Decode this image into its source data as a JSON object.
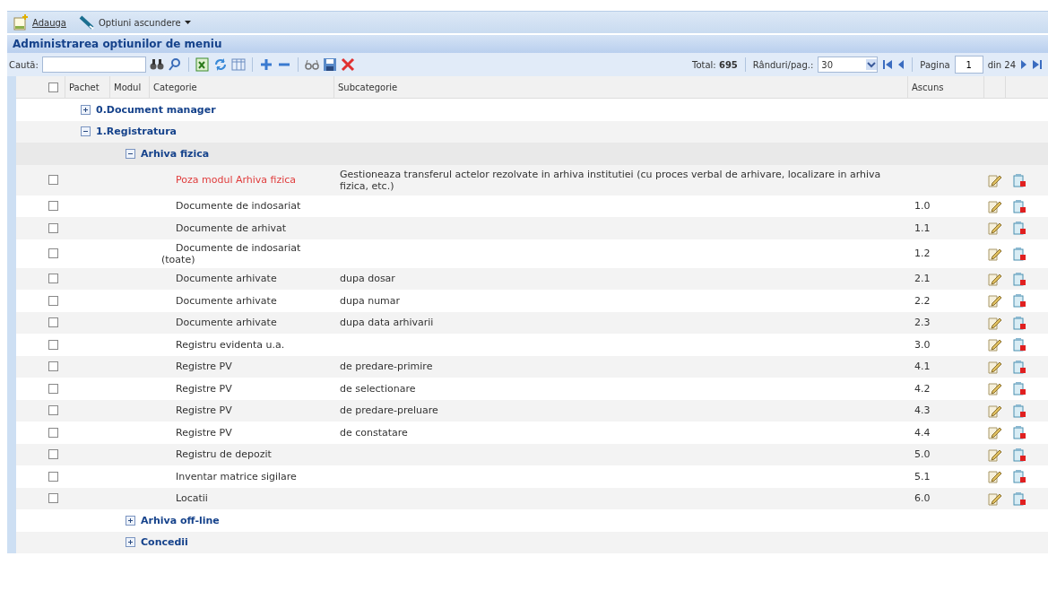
{
  "toolbar": {
    "buttons": [
      {
        "kind": "add",
        "label": "Adauga"
      },
      {
        "kind": "hide",
        "label": "Optiuni ascundere",
        "dropdown": true
      }
    ]
  },
  "panel_title": "Administrarea optiunilor de meniu",
  "search": {
    "label": "Cautã:"
  },
  "pager": {
    "total_label": "Total:",
    "total": "695",
    "rows_label": "Rânduri/pag.:",
    "rows_per_page": "30",
    "page_label": "Pagina",
    "page": "1",
    "of_label": "din 24"
  },
  "table": {
    "columns": [
      {
        "kind": "check",
        "checked": false
      },
      {
        "kind": "text",
        "label": "Pachet"
      },
      {
        "kind": "text",
        "label": "Modul"
      },
      {
        "kind": "text",
        "label": "Categorie"
      },
      {
        "kind": "text",
        "label": "Subcategorie"
      },
      {
        "kind": "text",
        "label": "Ascuns"
      }
    ],
    "groups": [
      {
        "label": "0.Document manager",
        "expanded": false
      },
      {
        "label": "1.Registratura",
        "expanded": true,
        "children": [
          {
            "label": "Arhiva fizica",
            "expanded": true,
            "items": [
              {
                "category": "Poza modul Arhiva fizica",
                "subcategory": "Gestioneaza transferul actelor rezolvate in arhiva institutiei (cu proces verbal de arhivare, localizare in arhiva fizica, etc.)",
                "highlighted": true,
                "checked": false
              },
              {
                "category": "Documente de indosariat",
                "order": "1.0",
                "highlighted": false,
                "checked": false
              },
              {
                "category": "Documente de arhivat",
                "order": "1.1",
                "highlighted": false,
                "checked": false
              },
              {
                "category": "Documente de indosariat (toate)",
                "order": "1.2",
                "highlighted": false,
                "checked": false
              },
              {
                "category": "Documente arhivate",
                "subcategory": "dupa dosar",
                "order": "2.1",
                "highlighted": false,
                "checked": false
              },
              {
                "category": "Documente arhivate",
                "subcategory": "dupa numar",
                "order": "2.2",
                "highlighted": false,
                "checked": false
              },
              {
                "category": "Documente arhivate",
                "subcategory": "dupa data arhivarii",
                "order": "2.3",
                "highlighted": false,
                "checked": false
              },
              {
                "category": "Registru evidenta u.a.",
                "order": "3.0",
                "highlighted": false,
                "checked": false
              },
              {
                "category": "Registre PV",
                "subcategory": "de predare-primire",
                "order": "4.1",
                "highlighted": false,
                "checked": false
              },
              {
                "category": "Registre PV",
                "subcategory": "de selectionare",
                "order": "4.2",
                "highlighted": false,
                "checked": false
              },
              {
                "category": "Registre PV",
                "subcategory": "de predare-preluare",
                "order": "4.3",
                "highlighted": false,
                "checked": false
              },
              {
                "category": "Registre PV",
                "subcategory": "de constatare",
                "order": "4.4",
                "highlighted": false,
                "checked": false
              },
              {
                "category": "Registru de depozit",
                "order": "5.0",
                "highlighted": false,
                "checked": false
              },
              {
                "category": "Inventar matrice sigilare",
                "order": "5.1",
                "highlighted": false,
                "checked": false
              },
              {
                "category": "Locatii",
                "order": "6.0",
                "highlighted": false,
                "checked": false
              }
            ]
          },
          {
            "label": "Arhiva off-line",
            "expanded": false
          },
          {
            "label": "Concedii",
            "expanded": false
          }
        ]
      }
    ]
  }
}
